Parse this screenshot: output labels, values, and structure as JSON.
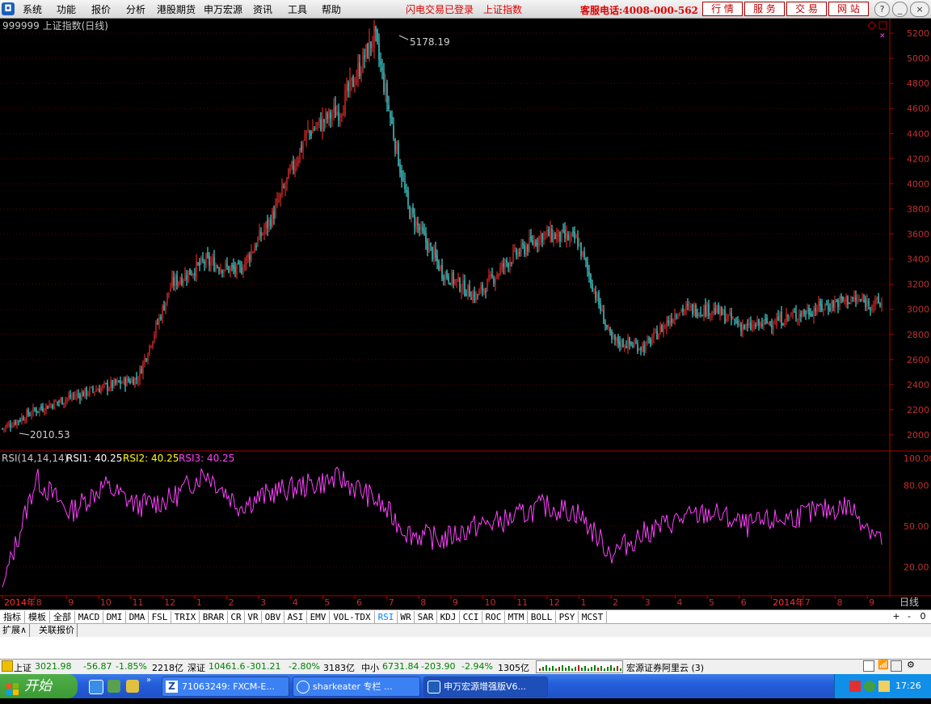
{
  "menu": {
    "items": [
      "系统",
      "功能",
      "报价",
      "分析",
      "港股期货",
      "申万宏源",
      "资讯",
      "工具",
      "帮助"
    ],
    "flash_login": "闪电交易已登录",
    "index_link": "上证指数",
    "hotline": "客服电话:4008-000-562",
    "buttons": [
      "行 情",
      "服 务",
      "交 易",
      "网 站"
    ],
    "window_controls": [
      "?",
      "_",
      "□",
      "×"
    ]
  },
  "chart": {
    "header": "999999 上证指数(日线)",
    "high_label": "5178.19",
    "low_label": "2010.53",
    "y_ticks": [
      5200,
      5000,
      4800,
      4600,
      4400,
      4200,
      4000,
      3800,
      3600,
      3400,
      3200,
      3000,
      2800,
      2600,
      2400,
      2200,
      2000
    ],
    "rsi_header": {
      "name": "RSI(14,14,14)",
      "rsi1": "RSI1: 40.25",
      "rsi2": "RSI2: 40.25",
      "rsi3": "RSI3: 40.25"
    },
    "rsi_ticks": [
      "100.00",
      "80.00",
      "50.00",
      "20.00"
    ],
    "x_axis": [
      {
        "label": "2014年",
        "red": true
      },
      {
        "label": "8"
      },
      {
        "label": "9"
      },
      {
        "label": "10"
      },
      {
        "label": "11"
      },
      {
        "label": "12"
      },
      {
        "label": "1"
      },
      {
        "label": "2"
      },
      {
        "label": "3"
      },
      {
        "label": "4"
      },
      {
        "label": "5"
      },
      {
        "label": "6"
      },
      {
        "label": "7"
      },
      {
        "label": "8"
      },
      {
        "label": "9"
      },
      {
        "label": "10"
      },
      {
        "label": "11"
      },
      {
        "label": "12"
      },
      {
        "label": "1"
      },
      {
        "label": "2"
      },
      {
        "label": "3"
      },
      {
        "label": "4"
      },
      {
        "label": "5"
      },
      {
        "label": "6"
      },
      {
        "label": "2014年",
        "red": true
      },
      {
        "label": "7"
      },
      {
        "label": "8"
      },
      {
        "label": "9"
      }
    ],
    "period": "日线",
    "colors": {
      "up": "#ff3232",
      "down": "#54ffff",
      "rsi": "#ff40ff",
      "axis": "#b00000"
    }
  },
  "chart_data": {
    "type": "candlestick",
    "title": "999999 上证指数(日线)",
    "series": [
      {
        "name": "上证指数",
        "close_path": [
          [
            "2014-07",
            2050
          ],
          [
            "2014-08",
            2200
          ],
          [
            "2014-09",
            2300
          ],
          [
            "2014-10",
            2380
          ],
          [
            "2014-11",
            2450
          ],
          [
            "2014-12",
            3200
          ],
          [
            "2015-01",
            3380
          ],
          [
            "2015-02",
            3300
          ],
          [
            "2015-03",
            3750
          ],
          [
            "2015-04",
            4400
          ],
          [
            "2015-05",
            4600
          ],
          [
            "2015-06",
            5178.19
          ],
          [
            "2015-07",
            3800
          ],
          [
            "2015-08",
            3300
          ],
          [
            "2015-09",
            3100
          ],
          [
            "2015-10",
            3400
          ],
          [
            "2015-11",
            3600
          ],
          [
            "2015-12",
            3550
          ],
          [
            "2016-01",
            2750
          ],
          [
            "2016-02",
            2700
          ],
          [
            "2016-03",
            3000
          ],
          [
            "2016-04",
            3000
          ],
          [
            "2016-05",
            2850
          ],
          [
            "2016-06",
            2920
          ],
          [
            "2016-07",
            3000
          ],
          [
            "2016-08",
            3080
          ],
          [
            "2016-09",
            3040
          ]
        ]
      },
      {
        "name": "RSI1",
        "values_summary": [
          5,
          85,
          60,
          80,
          65,
          70,
          90,
          65,
          75,
          80,
          85,
          70,
          45,
          40,
          50,
          55,
          65,
          60,
          30,
          45,
          55,
          60,
          50,
          55,
          60,
          65,
          40.25
        ]
      }
    ],
    "ylim": [
      2000,
      5200
    ],
    "rsi_ylim": [
      0,
      100
    ],
    "annotations": {
      "high": "5178.19",
      "low": "2010.53"
    }
  },
  "indicator_tabs": {
    "left": [
      "指标",
      "模板",
      "全部"
    ],
    "items": [
      "MACD",
      "DMI",
      "DMA",
      "FSL",
      "TRIX",
      "BRAR",
      "CR",
      "VR",
      "OBV",
      "ASI",
      "EMV",
      "VOL-TDX",
      "RSI",
      "WR",
      "SAR",
      "KDJ",
      "CCI",
      "ROC",
      "MTM",
      "BOLL",
      "PSY",
      "MCST"
    ],
    "active": "RSI",
    "controls": [
      "+",
      "-",
      "0"
    ]
  },
  "ext_tabs": [
    "扩展∧",
    "关联报价"
  ],
  "status": {
    "sh": {
      "name": "上证",
      "value": "3021.98",
      "chg": "-56.87",
      "pct": "-1.85%",
      "vol": "2218亿"
    },
    "sz": {
      "name": "深证",
      "value": "10461.6",
      "chg": "-301.21",
      "pct": "-2.80%",
      "vol": "3183亿"
    },
    "zx": {
      "name": "中小",
      "value": "6731.84",
      "chg": "-203.90",
      "pct": "-2.94%",
      "vol": "1305亿"
    },
    "broker": "宏源证券阿里云 (3)"
  },
  "taskbar": {
    "start": "开始",
    "tasks": [
      "71063249: FXCM-E...",
      "sharkeater 专栏 ...",
      "申万宏源增强版V6..."
    ],
    "time": "17:26"
  }
}
